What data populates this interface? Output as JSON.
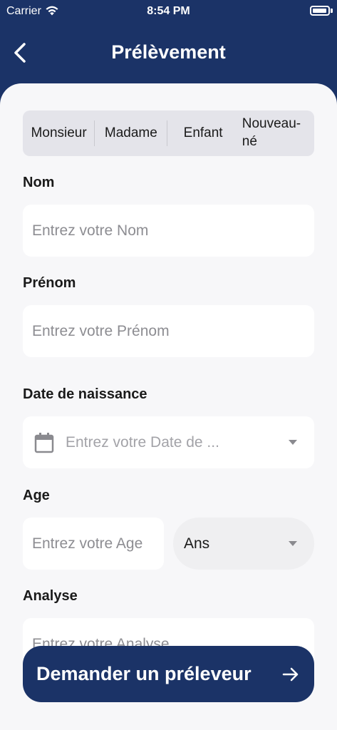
{
  "status_bar": {
    "carrier": "Carrier",
    "time": "8:54 PM"
  },
  "header": {
    "title": "Prélèvement"
  },
  "segments": [
    {
      "label": "Monsieur"
    },
    {
      "label": "Madame"
    },
    {
      "label": "Enfant"
    },
    {
      "label": "Nouveau-\nné"
    }
  ],
  "form": {
    "nom": {
      "label": "Nom",
      "placeholder": "Entrez votre Nom"
    },
    "prenom": {
      "label": "Prénom",
      "placeholder": "Entrez votre Prénom"
    },
    "date": {
      "label": "Date de naissance",
      "placeholder": "Entrez votre Date de ..."
    },
    "age": {
      "label": "Age",
      "placeholder": "Entrez votre Age",
      "unit": "Ans"
    },
    "analyse": {
      "label": "Analyse",
      "placeholder": "Entrez votre Analyse"
    }
  },
  "cta": {
    "label": "Demander un préleveur"
  },
  "colors": {
    "primary": "#1b3367",
    "background": "#f7f7f9"
  },
  "icons": {
    "back": "chevron-left-icon",
    "calendar": "calendar-icon",
    "dropdown": "caret-down-icon",
    "cta": "arrow-right-icon",
    "wifi": "wifi-icon",
    "battery": "battery-icon"
  }
}
